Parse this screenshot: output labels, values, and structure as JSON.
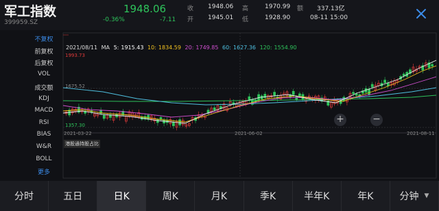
{
  "header": {
    "name": "军工指数",
    "code": "399959.SZ",
    "price": "1948.06",
    "change_pct": "-0.36%",
    "change": "-7.11",
    "quote": [
      {
        "label": "收",
        "value": "1948.06"
      },
      {
        "label": "高",
        "value": "1970.99"
      },
      {
        "label": "额",
        "value": "337.13亿"
      },
      {
        "label": "开",
        "value": "1945.01"
      },
      {
        "label": "低",
        "value": "1928.90"
      },
      {
        "label": "",
        "value": "08-11 15:00"
      }
    ]
  },
  "side_menu": [
    "不复权",
    "前复权",
    "后复权",
    "VOL",
    "成交额",
    "KDJ",
    "MACD",
    "RSI",
    "BIAS",
    "W&R",
    "BOLL",
    "更多"
  ],
  "ma": {
    "date": "2021/08/11",
    "label": "MA",
    "items": [
      {
        "name": "5:",
        "value": "1915.43",
        "color": "#ffffff"
      },
      {
        "name": "10:",
        "value": "1834.59",
        "color": "#f0c020"
      },
      {
        "name": "20:",
        "value": "1749.85",
        "color": "#d04fd0"
      },
      {
        "name": "60:",
        "value": "1627.36",
        "color": "#4fc0e0"
      },
      {
        "name": "120:",
        "value": "1554.90",
        "color": "#2ec35b"
      }
    ]
  },
  "price_labels": {
    "high": "1993.73",
    "mid": "1675.52",
    "low": "1357.30"
  },
  "dates": [
    "2021-03-22",
    "2021-06-02",
    "2021-08-11"
  ],
  "tip": "港股通持股占比",
  "tabs": [
    "分时",
    "五日",
    "日K",
    "周K",
    "月K",
    "季K",
    "半年K",
    "年K",
    "分钟"
  ],
  "active_tab": "日K",
  "colors": {
    "up": "#e03a3a",
    "down": "#2ec35b",
    "accent": "#3b8be8"
  }
}
